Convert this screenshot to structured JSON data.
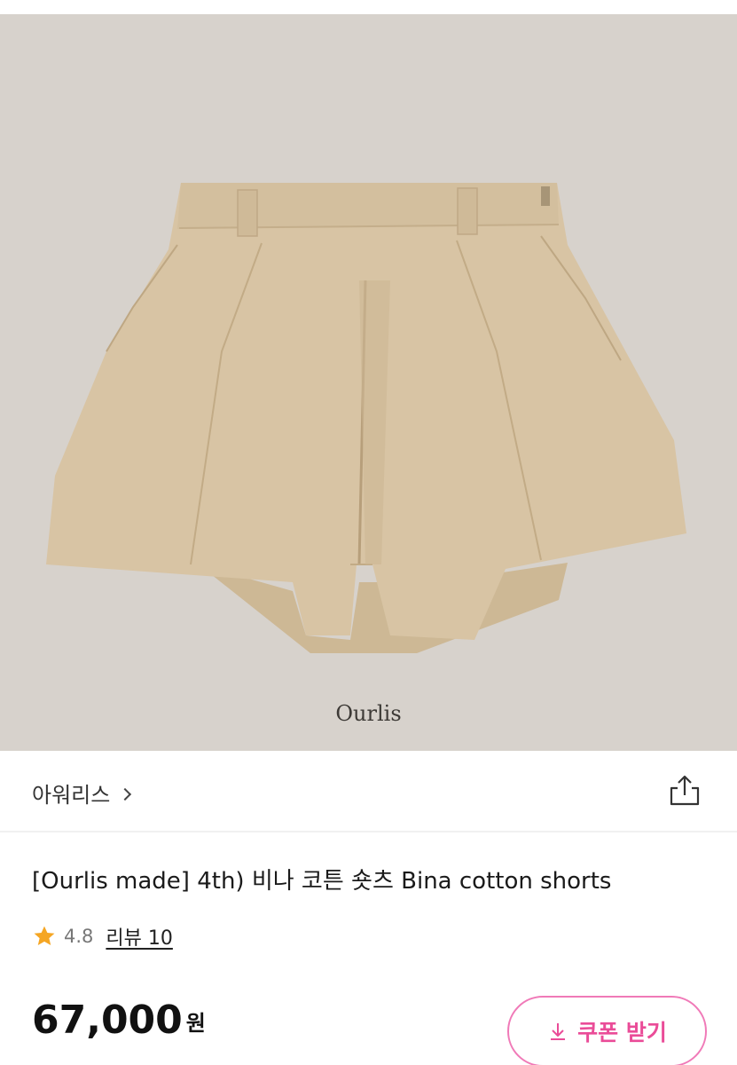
{
  "image": {
    "alt": "Bina cotton shorts beige",
    "brand_logo": "Ourlis",
    "background_color": "#d7d2cc",
    "garment_color": "#d8c4a4"
  },
  "shop": {
    "name": "아워리스",
    "chevron_icon": "chevron-right-icon",
    "share_icon": "share-icon"
  },
  "product": {
    "title": "[Ourlis made] 4th) 비나 코튼 숏츠 Bina cotton shorts",
    "rating": "4.8",
    "review_label": "리뷰 10",
    "star_icon": "star-icon",
    "star_color": "#f5a623",
    "price": "67,000",
    "currency": "원"
  },
  "coupon": {
    "label": "쿠폰 받기",
    "icon": "download-icon",
    "accent_color": "#ea4c98"
  }
}
